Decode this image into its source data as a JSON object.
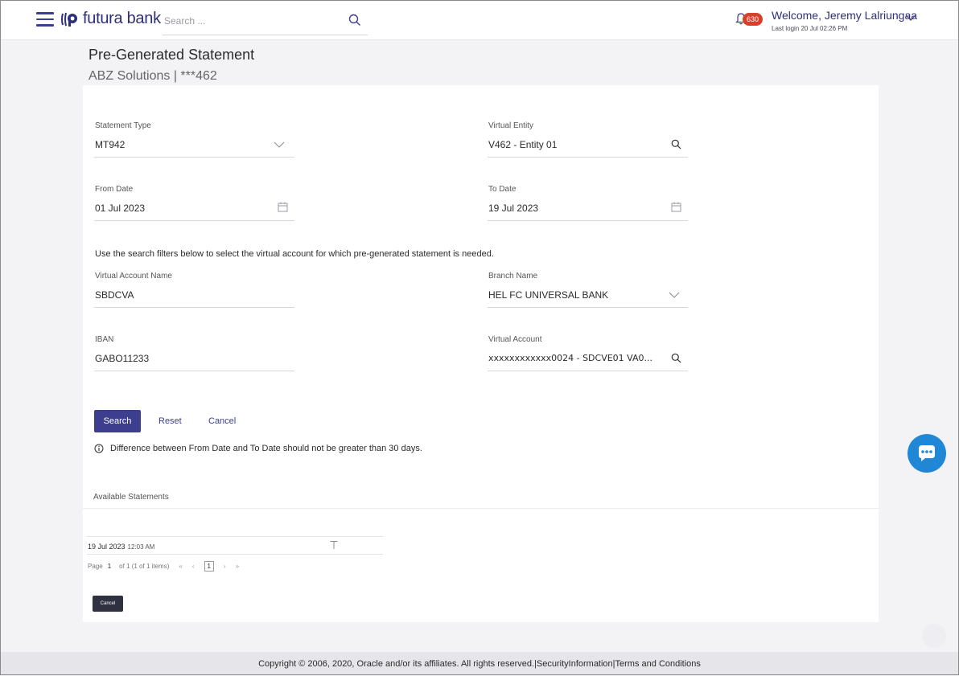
{
  "header": {
    "brand": "futura bank",
    "search_placeholder": "Search ...",
    "notification_count": "630",
    "welcome": "Welcome, Jeremy Lalriungaa",
    "last_login": "Last login 20 Jul 02:26 PM"
  },
  "page": {
    "title": "Pre-Generated Statement",
    "subtitle": "ABZ Solutions | ***462"
  },
  "form": {
    "statement_type": {
      "label": "Statement Type",
      "value": "MT942"
    },
    "virtual_entity": {
      "label": "Virtual Entity",
      "value": "V462 - Entity 01"
    },
    "from_date": {
      "label": "From Date",
      "value": "01 Jul 2023"
    },
    "to_date": {
      "label": "To Date",
      "value": "19 Jul 2023"
    },
    "hint": "Use the search filters below to select the virtual account for which pre-generated statement is needed.",
    "virtual_account_name": {
      "label": "Virtual Account Name",
      "value": "SBDCVA"
    },
    "branch_name": {
      "label": "Branch Name",
      "value": "HEL FC UNIVERSAL BANK"
    },
    "iban": {
      "label": "IBAN",
      "value": "GABO11233"
    },
    "virtual_account": {
      "label": "Virtual Account",
      "value": "xxxxxxxxxxxx0024 - SDCVE01 VA0..."
    }
  },
  "actions": {
    "search": "Search",
    "reset": "Reset",
    "cancel": "Cancel"
  },
  "info_message": "Difference between From Date and To Date should not be greater than 30 days.",
  "statements": {
    "title": "Available Statements",
    "rows": [
      {
        "date": "19 Jul 2023",
        "time": "12:03 AM"
      }
    ],
    "pager": {
      "page_label": "Page",
      "page": "1",
      "of_text": "of 1  (1 of 1 items)",
      "current": "1"
    },
    "cancel": "Cancel"
  },
  "footer": {
    "copyright": "Copyright © 2006, 2020, Oracle and/or its affiliates. All rights reserved.",
    "security": "SecurityInformation",
    "terms": "Terms and Conditions"
  },
  "colors": {
    "primary": "#3d3f8e",
    "badge": "#d9402b",
    "chat": "#1f87d6"
  }
}
